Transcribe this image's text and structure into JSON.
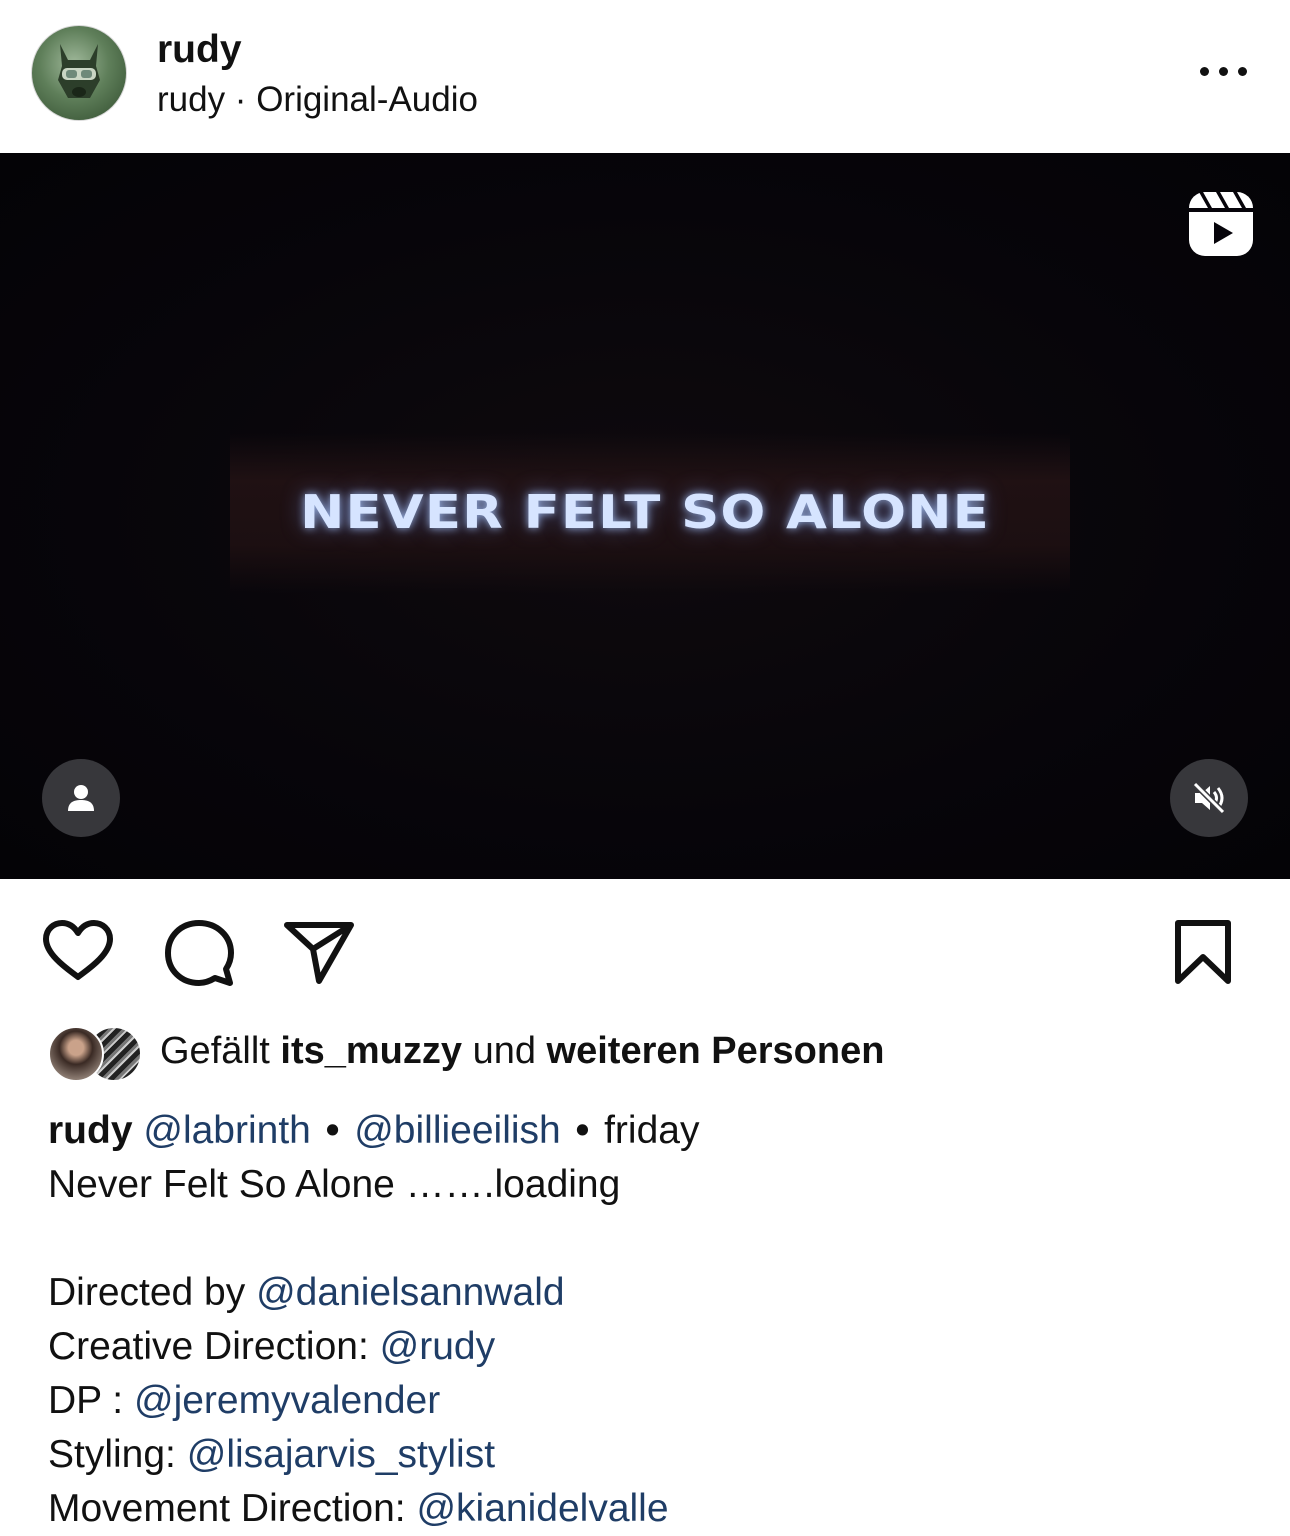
{
  "header": {
    "username": "rudy",
    "subline": "rudy · Original-Audio",
    "more_icon": "more-horizontal-icon"
  },
  "video": {
    "overlay_text": "NEVER FELT SO ALONE",
    "reels_icon": "reels-icon",
    "tag_icon": "person-tag-icon",
    "mute_icon": "speaker-muted-icon"
  },
  "actions": {
    "like_icon": "heart-icon",
    "comment_icon": "comment-bubble-icon",
    "share_icon": "paper-plane-icon",
    "save_icon": "bookmark-icon"
  },
  "likes": {
    "prefix": "Gefällt ",
    "user": "its_muzzy",
    "middle": " und ",
    "suffix": "weiteren Personen"
  },
  "caption": {
    "author": "rudy",
    "mention1": "@labrinth",
    "sep": "•",
    "mention2": "@billieeilish",
    "time": "friday",
    "line2": "Never Felt So Alone …….loading",
    "credits": [
      {
        "label": "Directed by ",
        "mention": "@danielsannwald"
      },
      {
        "label": "Creative Direction: ",
        "mention": "@rudy"
      },
      {
        "label": "DP : ",
        "mention": "@jeremyvalender"
      },
      {
        "label": "Styling: ",
        "mention": "@lisajarvis_stylist"
      },
      {
        "label": "Movement Direction: ",
        "mention": "@kianidelvalle"
      }
    ]
  },
  "colors": {
    "mention": "#1f3d66",
    "video_bg": "#06040a",
    "overlay_text": "#d6e4ff"
  }
}
